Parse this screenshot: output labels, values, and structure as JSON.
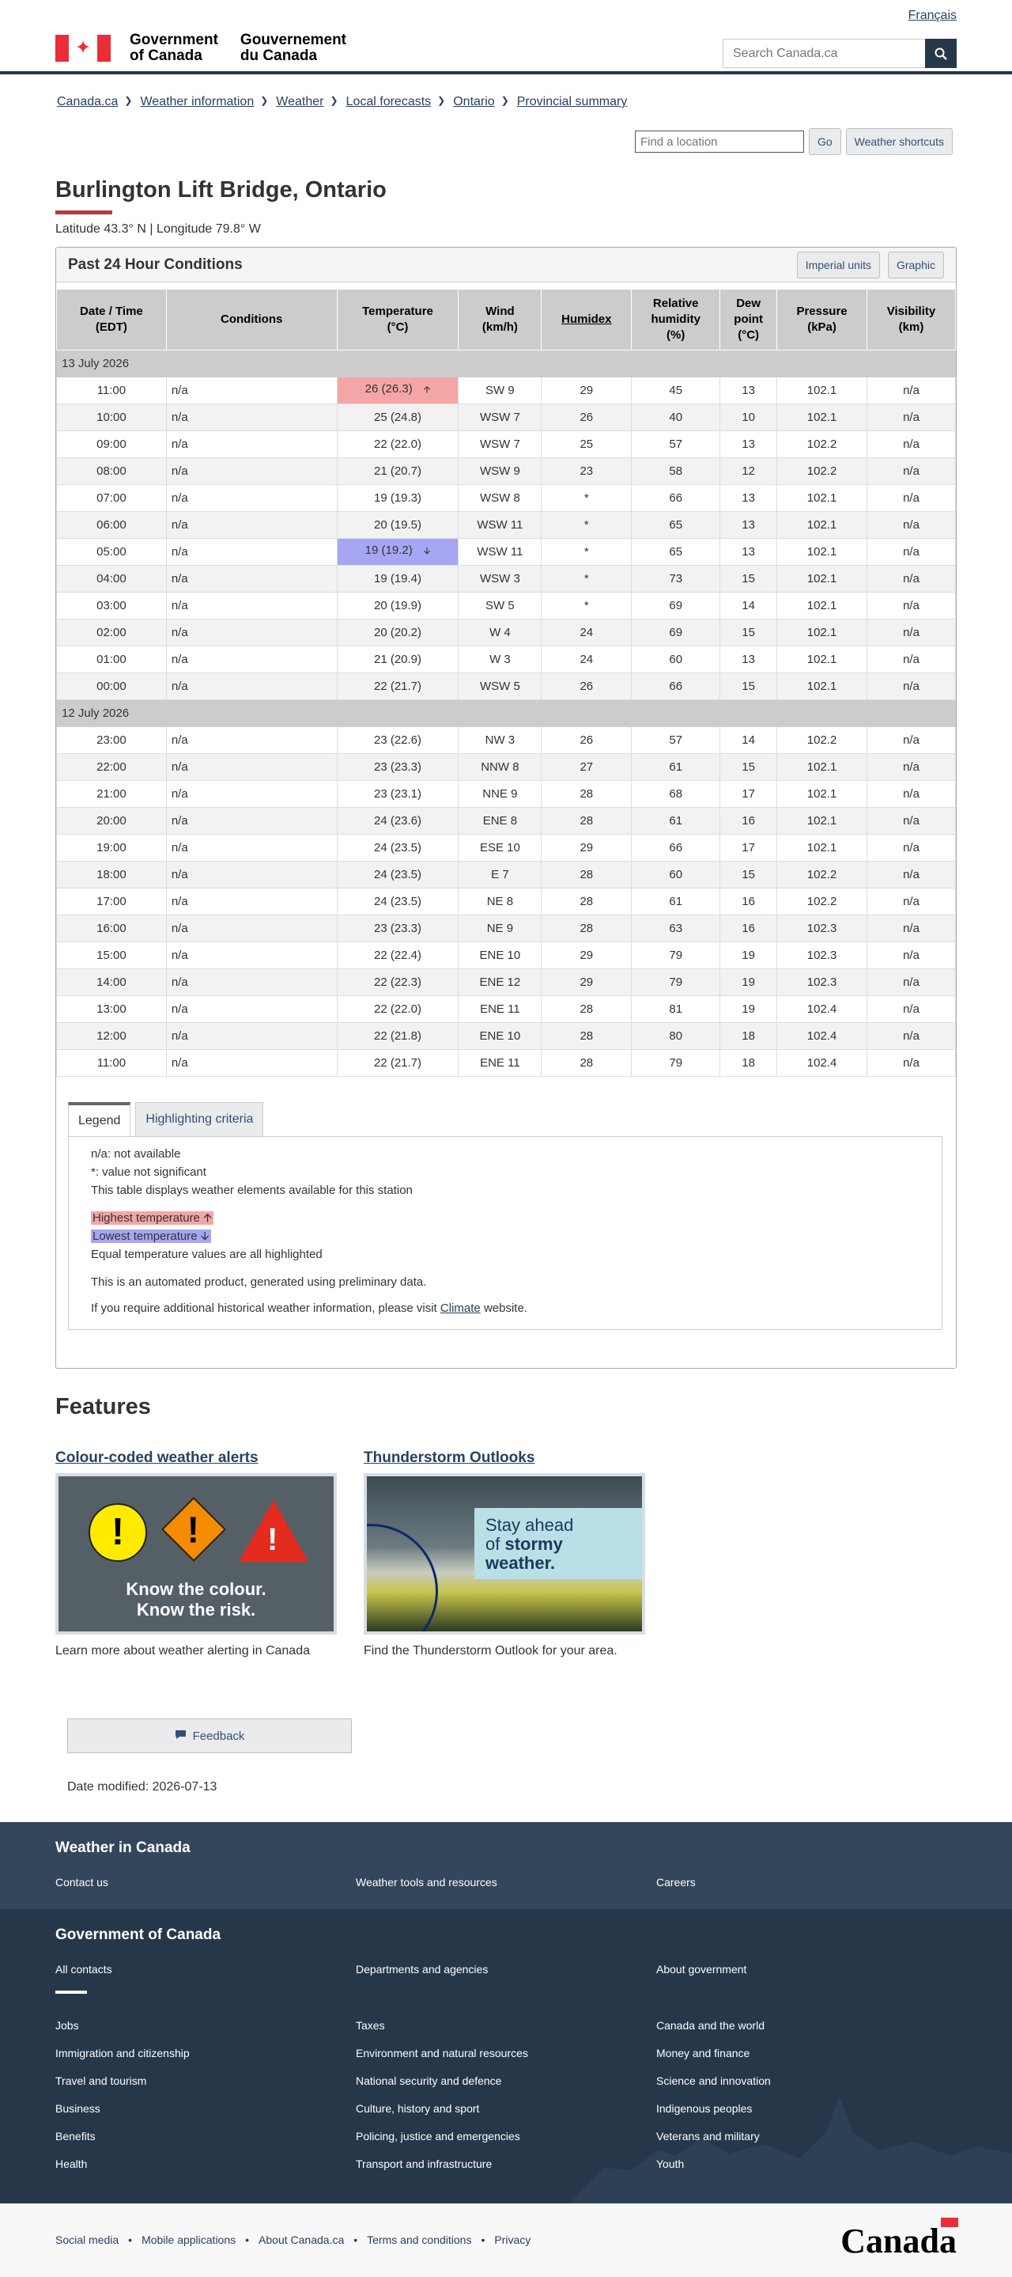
{
  "header": {
    "lang_link": "Français",
    "gov_en_1": "Government",
    "gov_en_2": "of Canada",
    "gov_fr_1": "Gouvernement",
    "gov_fr_2": "du Canada",
    "search_placeholder": "Search Canada.ca"
  },
  "breadcrumb": [
    "Canada.ca",
    "Weather information",
    "Weather",
    "Local forecasts",
    "Ontario",
    "Provincial summary"
  ],
  "location": {
    "placeholder": "Find a location",
    "go_label": "Go",
    "shortcuts_label": "Weather shortcuts"
  },
  "page": {
    "title": "Burlington Lift Bridge, Ontario",
    "latlon": "Latitude 43.3° N | Longitude 79.8° W"
  },
  "panel": {
    "title": "Past 24 Hour Conditions",
    "imperial_label": "Imperial units",
    "graphic_label": "Graphic"
  },
  "table": {
    "headers": {
      "datetime_1": "Date / Time",
      "datetime_2": "(EDT)",
      "conditions": "Conditions",
      "temp_1": "Temperature",
      "temp_2": "(°C)",
      "wind_1": "Wind",
      "wind_2": "(km/h)",
      "humidex": "Humidex",
      "rh_1": "Relative",
      "rh_2": "humidity",
      "rh_3": "(%)",
      "dew_1": "Dew",
      "dew_2": "point",
      "dew_3": "(°C)",
      "pressure_1": "Pressure",
      "pressure_2": "(kPa)",
      "vis_1": "Visibility",
      "vis_2": "(km)"
    },
    "day1": "13 July 2026",
    "day2": "12 July 2026",
    "rows_day1": [
      {
        "time": "11:00",
        "cond": "n/a",
        "temp": "26  (26.3)",
        "wind": "SW 9",
        "humidex": "29",
        "rh": "45",
        "dew": "13",
        "pres": "102.1",
        "vis": "n/a",
        "flag": "hi"
      },
      {
        "time": "10:00",
        "cond": "n/a",
        "temp": "25  (24.8)",
        "wind": "WSW 7",
        "humidex": "26",
        "rh": "40",
        "dew": "10",
        "pres": "102.1",
        "vis": "n/a"
      },
      {
        "time": "09:00",
        "cond": "n/a",
        "temp": "22  (22.0)",
        "wind": "WSW 7",
        "humidex": "25",
        "rh": "57",
        "dew": "13",
        "pres": "102.2",
        "vis": "n/a"
      },
      {
        "time": "08:00",
        "cond": "n/a",
        "temp": "21  (20.7)",
        "wind": "WSW 9",
        "humidex": "23",
        "rh": "58",
        "dew": "12",
        "pres": "102.2",
        "vis": "n/a"
      },
      {
        "time": "07:00",
        "cond": "n/a",
        "temp": "19  (19.3)",
        "wind": "WSW 8",
        "humidex": "*",
        "rh": "66",
        "dew": "13",
        "pres": "102.1",
        "vis": "n/a"
      },
      {
        "time": "06:00",
        "cond": "n/a",
        "temp": "20  (19.5)",
        "wind": "WSW 11",
        "humidex": "*",
        "rh": "65",
        "dew": "13",
        "pres": "102.1",
        "vis": "n/a"
      },
      {
        "time": "05:00",
        "cond": "n/a",
        "temp": "19  (19.2)",
        "wind": "WSW 11",
        "humidex": "*",
        "rh": "65",
        "dew": "13",
        "pres": "102.1",
        "vis": "n/a",
        "flag": "lo"
      },
      {
        "time": "04:00",
        "cond": "n/a",
        "temp": "19  (19.4)",
        "wind": "WSW 3",
        "humidex": "*",
        "rh": "73",
        "dew": "15",
        "pres": "102.1",
        "vis": "n/a"
      },
      {
        "time": "03:00",
        "cond": "n/a",
        "temp": "20  (19.9)",
        "wind": "SW 5",
        "humidex": "*",
        "rh": "69",
        "dew": "14",
        "pres": "102.1",
        "vis": "n/a"
      },
      {
        "time": "02:00",
        "cond": "n/a",
        "temp": "20  (20.2)",
        "wind": "W 4",
        "humidex": "24",
        "rh": "69",
        "dew": "15",
        "pres": "102.1",
        "vis": "n/a"
      },
      {
        "time": "01:00",
        "cond": "n/a",
        "temp": "21  (20.9)",
        "wind": "W 3",
        "humidex": "24",
        "rh": "60",
        "dew": "13",
        "pres": "102.1",
        "vis": "n/a"
      },
      {
        "time": "00:00",
        "cond": "n/a",
        "temp": "22  (21.7)",
        "wind": "WSW 5",
        "humidex": "26",
        "rh": "66",
        "dew": "15",
        "pres": "102.1",
        "vis": "n/a"
      }
    ],
    "rows_day2": [
      {
        "time": "23:00",
        "cond": "n/a",
        "temp": "23  (22.6)",
        "wind": "NW 3",
        "humidex": "26",
        "rh": "57",
        "dew": "14",
        "pres": "102.2",
        "vis": "n/a"
      },
      {
        "time": "22:00",
        "cond": "n/a",
        "temp": "23  (23.3)",
        "wind": "NNW 8",
        "humidex": "27",
        "rh": "61",
        "dew": "15",
        "pres": "102.1",
        "vis": "n/a"
      },
      {
        "time": "21:00",
        "cond": "n/a",
        "temp": "23  (23.1)",
        "wind": "NNE 9",
        "humidex": "28",
        "rh": "68",
        "dew": "17",
        "pres": "102.1",
        "vis": "n/a"
      },
      {
        "time": "20:00",
        "cond": "n/a",
        "temp": "24  (23.6)",
        "wind": "ENE 8",
        "humidex": "28",
        "rh": "61",
        "dew": "16",
        "pres": "102.1",
        "vis": "n/a"
      },
      {
        "time": "19:00",
        "cond": "n/a",
        "temp": "24  (23.5)",
        "wind": "ESE 10",
        "humidex": "29",
        "rh": "66",
        "dew": "17",
        "pres": "102.1",
        "vis": "n/a"
      },
      {
        "time": "18:00",
        "cond": "n/a",
        "temp": "24  (23.5)",
        "wind": "E 7",
        "humidex": "28",
        "rh": "60",
        "dew": "15",
        "pres": "102.2",
        "vis": "n/a"
      },
      {
        "time": "17:00",
        "cond": "n/a",
        "temp": "24  (23.5)",
        "wind": "NE 8",
        "humidex": "28",
        "rh": "61",
        "dew": "16",
        "pres": "102.2",
        "vis": "n/a"
      },
      {
        "time": "16:00",
        "cond": "n/a",
        "temp": "23  (23.3)",
        "wind": "NE 9",
        "humidex": "28",
        "rh": "63",
        "dew": "16",
        "pres": "102.3",
        "vis": "n/a"
      },
      {
        "time": "15:00",
        "cond": "n/a",
        "temp": "22  (22.4)",
        "wind": "ENE 10",
        "humidex": "29",
        "rh": "79",
        "dew": "19",
        "pres": "102.3",
        "vis": "n/a"
      },
      {
        "time": "14:00",
        "cond": "n/a",
        "temp": "22  (22.3)",
        "wind": "ENE 12",
        "humidex": "29",
        "rh": "79",
        "dew": "19",
        "pres": "102.3",
        "vis": "n/a"
      },
      {
        "time": "13:00",
        "cond": "n/a",
        "temp": "22  (22.0)",
        "wind": "ENE 11",
        "humidex": "28",
        "rh": "81",
        "dew": "19",
        "pres": "102.4",
        "vis": "n/a"
      },
      {
        "time": "12:00",
        "cond": "n/a",
        "temp": "22  (21.8)",
        "wind": "ENE 10",
        "humidex": "28",
        "rh": "80",
        "dew": "18",
        "pres": "102.4",
        "vis": "n/a"
      },
      {
        "time": "11:00",
        "cond": "n/a",
        "temp": "22  (21.7)",
        "wind": "ENE 11",
        "humidex": "28",
        "rh": "79",
        "dew": "18",
        "pres": "102.4",
        "vis": "n/a"
      }
    ]
  },
  "legend": {
    "tab_legend": "Legend",
    "tab_criteria": "Highlighting criteria",
    "na": "n/a: not available",
    "star": "*: value not significant",
    "elements": "This table displays weather elements available for this station",
    "highest": "Highest temperature",
    "lowest": "Lowest temperature",
    "equal": "Equal temperature values are all highlighted",
    "automated": "This is an automated product, generated using preliminary data.",
    "climate_pre": "If you require additional historical weather information, please visit",
    "climate_link": "Climate",
    "climate_post": "website."
  },
  "features": {
    "heading": "Features",
    "f1_title": "Colour-coded weather alerts",
    "f1_img_line1": "Know the colour.",
    "f1_img_line2": "Know the risk.",
    "f1_desc": "Learn more about weather alerting in Canada",
    "f2_title": "Thunderstorm Outlooks",
    "f2_img_1": "Stay ahead",
    "f2_img_2": "of",
    "f2_img_3": "stormy",
    "f2_img_4": "weather.",
    "f2_desc": "Find the Thunderstorm Outlook for your area."
  },
  "feedback_label": "Feedback",
  "date_modified": "Date modified: 2026-07-13",
  "footer1": {
    "heading": "Weather in Canada",
    "links": [
      "Contact us",
      "Weather tools and resources",
      "Careers"
    ]
  },
  "footer2": {
    "heading": "Government of Canada",
    "top_links": [
      "All contacts",
      "Departments and agencies",
      "About government"
    ],
    "col1": [
      "Jobs",
      "Immigration and citizenship",
      "Travel and tourism",
      "Business",
      "Benefits",
      "Health"
    ],
    "col2": [
      "Taxes",
      "Environment and natural resources",
      "National security and defence",
      "Culture, history and sport",
      "Policing, justice and emergencies",
      "Transport and infrastructure"
    ],
    "col3": [
      "Canada and the world",
      "Money and finance",
      "Science and innovation",
      "Indigenous peoples",
      "Veterans and military",
      "Youth"
    ]
  },
  "footer3": {
    "links": [
      "Social media",
      "Mobile applications",
      "About Canada.ca",
      "Terms and conditions",
      "Privacy"
    ],
    "wordmark": "Canada"
  },
  "colors": {
    "accent": "#af3c43",
    "nav_dark": "#26374a",
    "highest": "#f4a6a6",
    "lowest": "#a6a6f4"
  }
}
